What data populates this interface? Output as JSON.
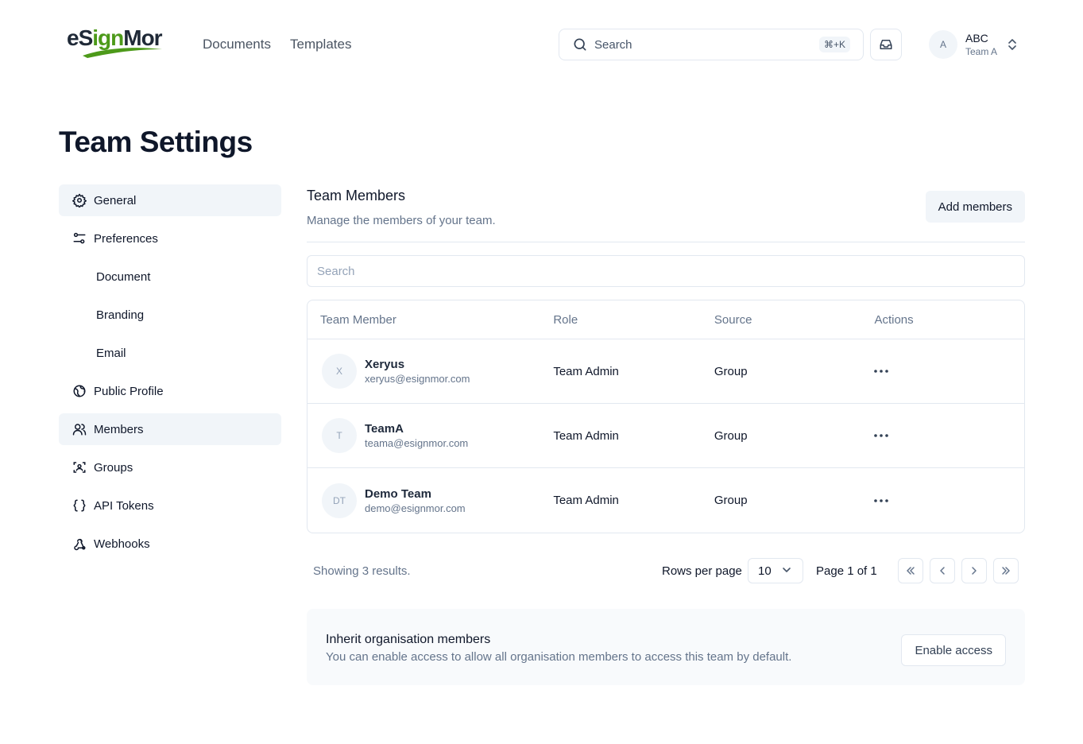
{
  "header": {
    "logo": {
      "part1": "eS",
      "part2": "ign",
      "part3": "Mor"
    },
    "nav": [
      {
        "label": "Documents"
      },
      {
        "label": "Templates"
      }
    ],
    "search": {
      "label": "Search",
      "shortcut": "⌘+K"
    },
    "user": {
      "initial": "A",
      "name": "ABC",
      "team": "Team A"
    }
  },
  "page": {
    "title": "Team Settings"
  },
  "sidebar": {
    "items": [
      {
        "label": "General",
        "icon": "gear-icon"
      },
      {
        "label": "Preferences",
        "icon": "sliders-icon"
      },
      {
        "label": "Document"
      },
      {
        "label": "Branding"
      },
      {
        "label": "Email"
      },
      {
        "label": "Public Profile",
        "icon": "globe-icon"
      },
      {
        "label": "Members",
        "icon": "users-icon"
      },
      {
        "label": "Groups",
        "icon": "groups-icon"
      },
      {
        "label": "API Tokens",
        "icon": "braces-icon"
      },
      {
        "label": "Webhooks",
        "icon": "webhook-icon"
      }
    ],
    "active": [
      "General",
      "Members"
    ]
  },
  "members": {
    "title": "Team Members",
    "subtitle": "Manage the members of your team.",
    "add_button": "Add members",
    "search_placeholder": "Search",
    "columns": [
      "Team Member",
      "Role",
      "Source",
      "Actions"
    ],
    "rows": [
      {
        "initials": "X",
        "name": "Xeryus",
        "email": "xeryus@esignmor.com",
        "role": "Team Admin",
        "source": "Group"
      },
      {
        "initials": "T",
        "name": "TeamA",
        "email": "teama@esignmor.com",
        "role": "Team Admin",
        "source": "Group"
      },
      {
        "initials": "DT",
        "name": "Demo Team",
        "email": "demo@esignmor.com",
        "role": "Team Admin",
        "source": "Group"
      }
    ]
  },
  "pagination": {
    "showing": "Showing 3 results.",
    "rows_per_page_label": "Rows per page",
    "rows_per_page_value": "10",
    "page_label": "Page 1 of 1"
  },
  "inherit": {
    "title": "Inherit organisation members",
    "subtitle": "You can enable access to allow all organisation members to access this team by default.",
    "button": "Enable access"
  },
  "colors": {
    "brand_green": "#4d9a1a",
    "active_bg": "#f1f5f9",
    "border": "#e2e8f0"
  }
}
